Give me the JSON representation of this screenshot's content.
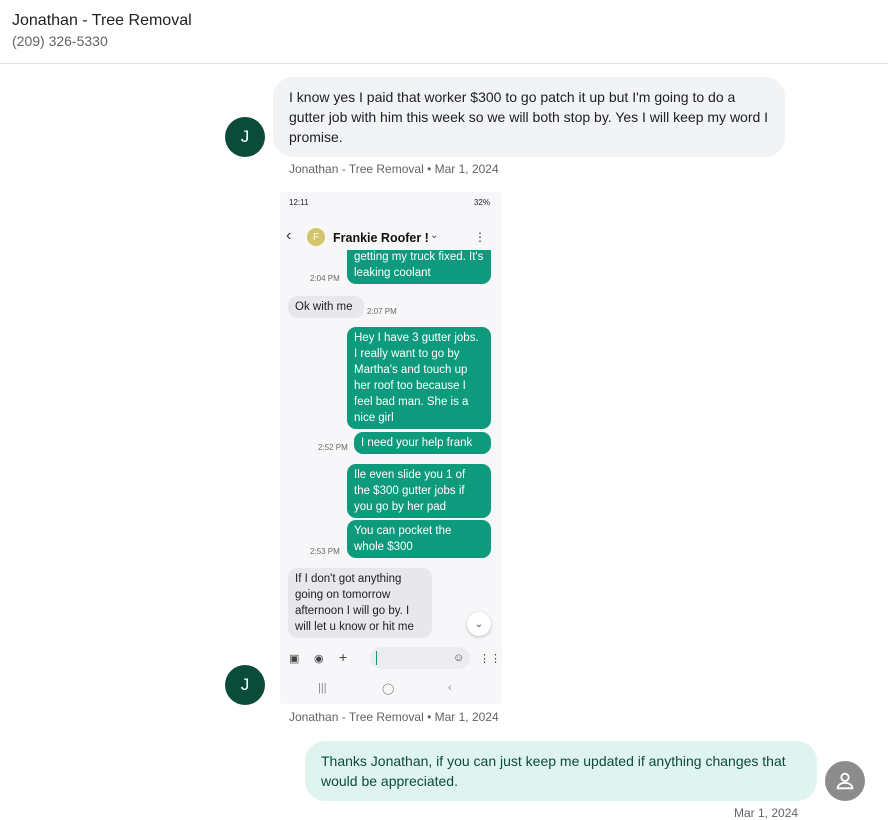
{
  "header": {
    "contact_name": "Jonathan - Tree Removal",
    "phone": "(209) 326-5330"
  },
  "messages": [
    {
      "direction": "incoming",
      "avatar_letter": "J",
      "text": "I know yes I paid that worker $300 to go patch it up but I'm going to do a gutter job with him this week so we will both stop by. Yes I will keep my word I promise.",
      "meta": "Jonathan - Tree Removal • Mar 1, 2024"
    },
    {
      "direction": "incoming",
      "avatar_letter": "J",
      "type": "image",
      "meta": "Jonathan - Tree Removal • Mar 1, 2024"
    },
    {
      "direction": "outgoing",
      "text": "Thanks Jonathan, if you can just keep me updated if anything changes that would be appreciated.",
      "meta": "Mar 1, 2024"
    }
  ],
  "screenshot": {
    "status_time": "12:11",
    "status_right": "32%",
    "contact_initial": "F",
    "contact_name": "Frankie Roofer !",
    "bubbles": [
      {
        "dir": "out",
        "text": "getting my truck fixed. It's leaking coolant"
      },
      {
        "dir": "in",
        "text": "Ok with me"
      },
      {
        "dir": "out",
        "text": "Hey I have 3 gutter jobs. I really want to go by Martha's and touch up her roof too because I feel bad man. She is a nice girl"
      },
      {
        "dir": "out",
        "text": "I need your help frank"
      },
      {
        "dir": "out",
        "text": "Ile even slide you 1 of the $300 gutter jobs if you go by her pad"
      },
      {
        "dir": "out",
        "text": "You can pocket the whole $300"
      },
      {
        "dir": "in",
        "text": "If I don't got anything going on tomorrow afternoon I will go by. I will let u know or hit me"
      }
    ],
    "timestamps": [
      "2:04 PM",
      "2:07 PM",
      "2:52 PM",
      "2:53 PM"
    ],
    "icons": [
      "gallery-icon",
      "camera-icon",
      "plus-icon",
      "emoji-icon",
      "voice-icon",
      "scroll-down-icon"
    ]
  },
  "colors": {
    "avatar_contact": "#0b4b3a",
    "avatar_me": "#8c8c8c",
    "outgoing_bubble": "#e0f4ef",
    "incoming_bubble": "#f1f3f4",
    "sms_outgoing": "#0e9a7c"
  }
}
